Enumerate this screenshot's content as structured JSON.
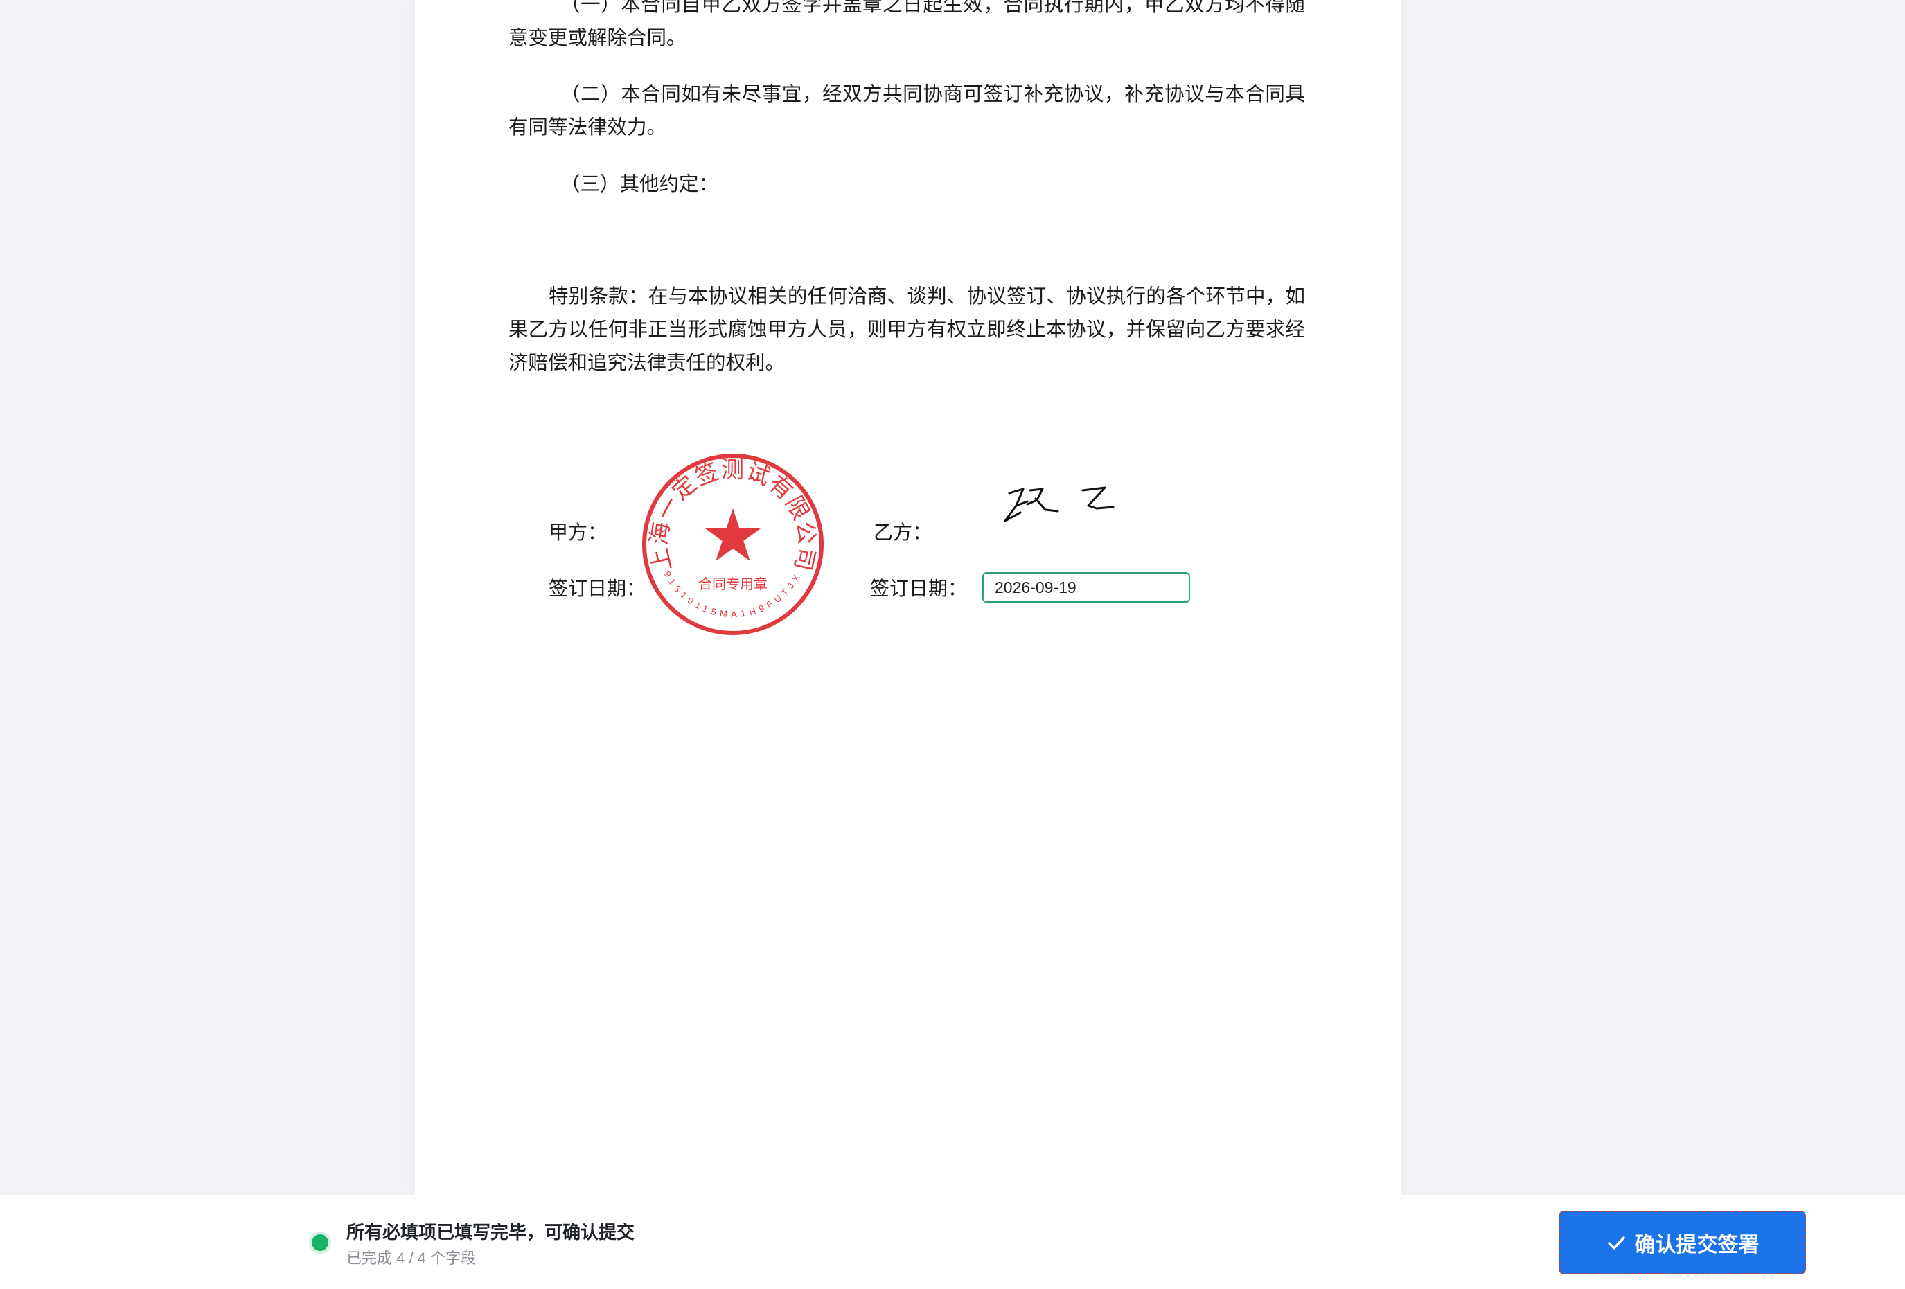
{
  "contract": {
    "clause_1": "（一）本合同自甲乙双方签字并盖章之日起生效，合同执行期内，甲乙双方均不得随意变更或解除合同。",
    "clause_2": "（二）本合同如有未尽事宜，经双方共同协商可签订补充协议，补充协议与本合同具有同等法律效力。",
    "clause_3": "（三）其他约定：",
    "special_terms": "特别条款：在与本协议相关的任何洽商、谈判、协议签订、协议执行的各个环节中，如果乙方以任何非正当形式腐蚀甲方人员，则甲方有权立即终止本协议，并保留向乙方要求经济赔偿和追究法律责任的权利。"
  },
  "signatures": {
    "party_a_label": "甲方：",
    "party_b_label": "乙方：",
    "date_a_label": "签订日期：",
    "date_b_label": "签订日期：",
    "date_b_value": "2026-09-19",
    "seal": {
      "company": "上海一定签测试有限公司",
      "type": "合同专用章",
      "code": "91310115MA1H9FUTJX",
      "color": "#e0393e"
    },
    "handwritten_signature": "张乙"
  },
  "footer": {
    "status_title": "所有必填项已填写完毕，可确认提交",
    "status_sub": "已完成 4 / 4 个字段",
    "status_color": "#18b26b",
    "submit_label": "确认提交签署",
    "submit_icon": "check-icon",
    "accent": "#1a73e8"
  }
}
